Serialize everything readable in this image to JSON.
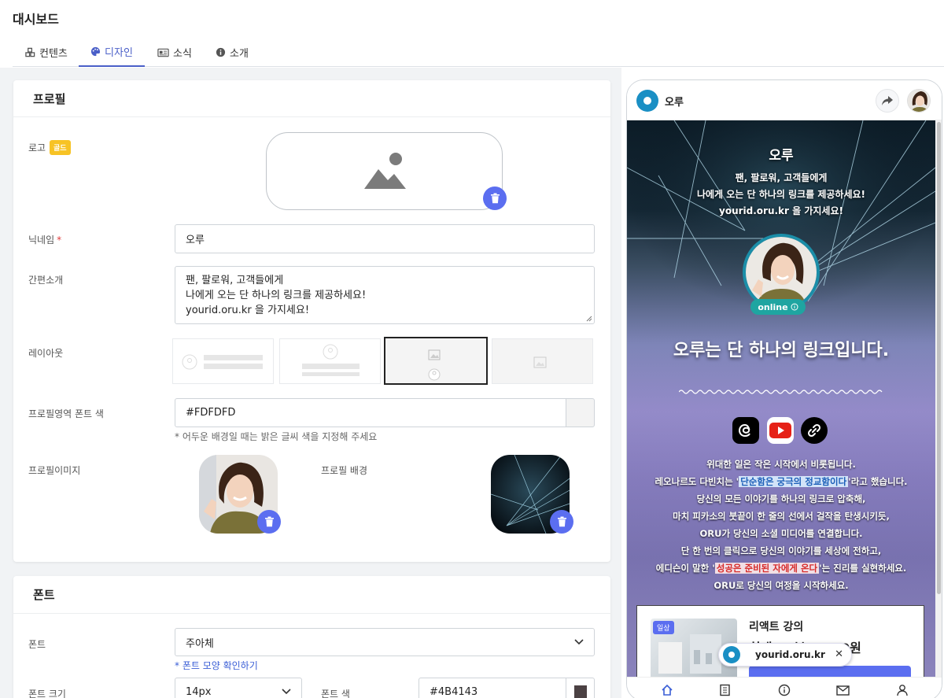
{
  "page": {
    "title": "대시보드"
  },
  "tabs": [
    {
      "label": "컨텐츠",
      "icon": "cubes-icon"
    },
    {
      "label": "디자인",
      "icon": "palette-icon",
      "active": true
    },
    {
      "label": "소식",
      "icon": "newspaper-icon"
    },
    {
      "label": "소개",
      "icon": "info-icon"
    }
  ],
  "profile_card": {
    "title": "프로필",
    "logo_label": "로고",
    "logo_badge": "골드",
    "nickname_label": "닉네임",
    "nickname_required": "*",
    "nickname_value": "오루",
    "bio_label": "간편소개",
    "bio_lines": [
      "팬, 팔로워, 고객들에게",
      "나에게 오는 단 하나의 링크를 제공하세요!",
      "yourid.oru.kr 을 가지세요!"
    ],
    "layout_label": "레이아웃",
    "layout_selected_index": 2,
    "font_color_label": "프로필영역 폰트 색",
    "font_color_value": "#FDFDFD",
    "font_color_hint": "* 어두운 배경일 때는 밝은 글씨 색을 지정해 주세요",
    "profile_image_label": "프로필이미지",
    "profile_bg_label": "프로필 배경"
  },
  "font_card": {
    "title": "폰트",
    "font_label": "폰트",
    "font_value": "주아체",
    "font_link": "* 폰트 모양 확인하기",
    "size_label": "폰트 크기",
    "size_value": "14px",
    "color_label": "폰트 색",
    "color_value": "#4B4143"
  },
  "preview": {
    "header_title": "오루",
    "name": "오루",
    "bio_lines": [
      "팬, 팔로워, 고객들에게",
      "나에게 오는 단 하나의 링크를 제공하세요!",
      "yourid.oru.kr 을 가지세요!"
    ],
    "online_label": "online",
    "headline": "오루는 단 하나의 링크입니다.",
    "desc": {
      "l1": "위대한 일은 작은 시작에서 비롯됩니다.",
      "l2_pre": "레오나르도 다빈치는 '",
      "l2_hl": "단순함은 궁극의 정교함이다",
      "l2_post": "'라고 했습니다.",
      "l3": "당신의 모든 이야기를 하나의 링크로 압축해,",
      "l4": "마치 피카소의 붓끝이 한 줄의 선에서 걸작을 탄생시키듯,",
      "l5": "ORU가 당신의 소셜 미디어를 연결합니다.",
      "l6": "단 한 번의 클릭으로 당신의 이야기를 세상에 전하고,",
      "l7_pre": "에디슨이 말한 '",
      "l7_hl": "성공은 준비된 자에게 온다",
      "l7_post": "'는 진리를 실현하세요.",
      "l8": "ORU로 당신의 여정을 시작하세요."
    },
    "card": {
      "badge": "일상",
      "title": "리액트 강의",
      "subtitle": "최대 10분 3,000원"
    },
    "url_chip": {
      "text": "yourid.oru.kr",
      "close": "✕"
    },
    "sns": [
      "threads-icon",
      "youtube-icon",
      "link-icon"
    ],
    "nav": [
      "home-icon",
      "book-icon",
      "info-icon",
      "mail-icon",
      "user-icon"
    ]
  },
  "colors": {
    "accent": "#5b6ef0",
    "tab_active": "#4a5fc8",
    "gold": "#f7c325",
    "online": "#1fa5a1"
  }
}
